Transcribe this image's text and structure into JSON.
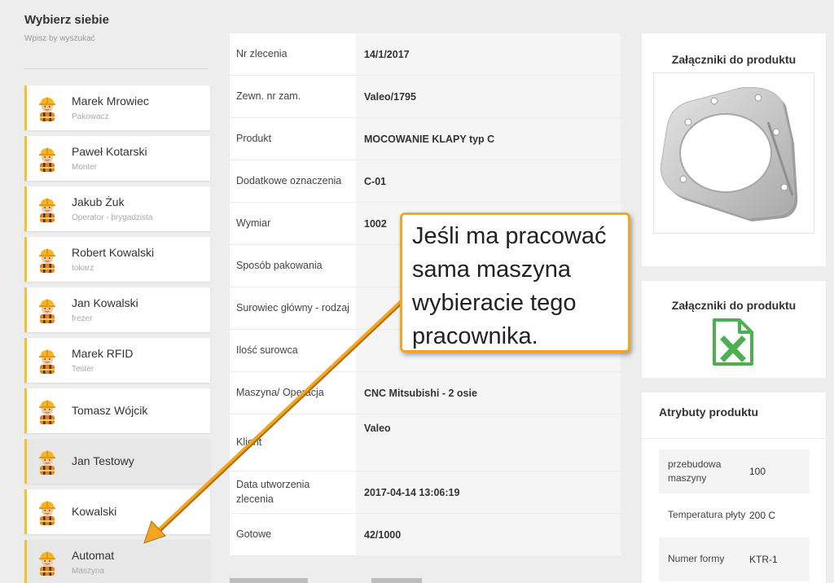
{
  "left": {
    "title": "Wybierz siebie",
    "hint": "Wpisz by wyszukać",
    "workers": [
      {
        "name": "Marek Mrowiec",
        "role": "Pakowacz"
      },
      {
        "name": "Paweł Kotarski",
        "role": "Monter"
      },
      {
        "name": "Jakub Żuk",
        "role": "Operator - brygadzista"
      },
      {
        "name": "Robert Kowalski",
        "role": "tokarz"
      },
      {
        "name": "Jan Kowalski",
        "role": "frezer"
      },
      {
        "name": "Marek RFID",
        "role": "Tester"
      },
      {
        "name": "Tomasz Wójcik",
        "role": ""
      },
      {
        "name": "Jan Testowy",
        "role": ""
      },
      {
        "name": "Kowalski",
        "role": ""
      },
      {
        "name": "Automat",
        "role": "Maszyna"
      }
    ]
  },
  "details": {
    "rows": [
      {
        "label": "Nr zlecenia",
        "value": "14/1/2017"
      },
      {
        "label": "Zewn. nr zam.",
        "value": "Valeo/1795"
      },
      {
        "label": "Produkt",
        "value": "MOCOWANIE KLAPY typ C"
      },
      {
        "label": "Dodatkowe oznaczenia",
        "value": "C-01"
      },
      {
        "label": "Wymiar",
        "value": "1002"
      },
      {
        "label": "Sposób pakowania",
        "value": ""
      },
      {
        "label": "Surowiec główny - rodzaj",
        "value": ""
      },
      {
        "label": "Ilość surowca",
        "value": ""
      },
      {
        "label": "Maszyna/ Operacja",
        "value": "CNC Mitsubishi - 2 osie"
      },
      {
        "label": "Klient",
        "value": "Valeo"
      },
      {
        "label": "Data utworzenia zlecenia",
        "value": "2017-04-14 13:06:19"
      },
      {
        "label": "Gotowe",
        "value": "42/1000"
      }
    ]
  },
  "attachments": {
    "image_title": "Załączniki do produktu",
    "file_title": "Załączniki do produktu",
    "file_icon": "excel-file-icon",
    "image_icon": "metal-bracket-image"
  },
  "attributes": {
    "title": "Atrybuty produktu",
    "rows": [
      {
        "name": "przebudowa maszyny",
        "value": "100"
      },
      {
        "name": "Temperatura płyty",
        "value": "200 C"
      },
      {
        "name": "Numer formy",
        "value": "KTR-1"
      }
    ]
  },
  "callout": {
    "text": "Jeśli ma pracować sama maszyna wybieracie tego pracownika."
  },
  "colors": {
    "accent": "#f2c230",
    "callout_border": "#f2a623",
    "excel_green": "#4caf50"
  }
}
